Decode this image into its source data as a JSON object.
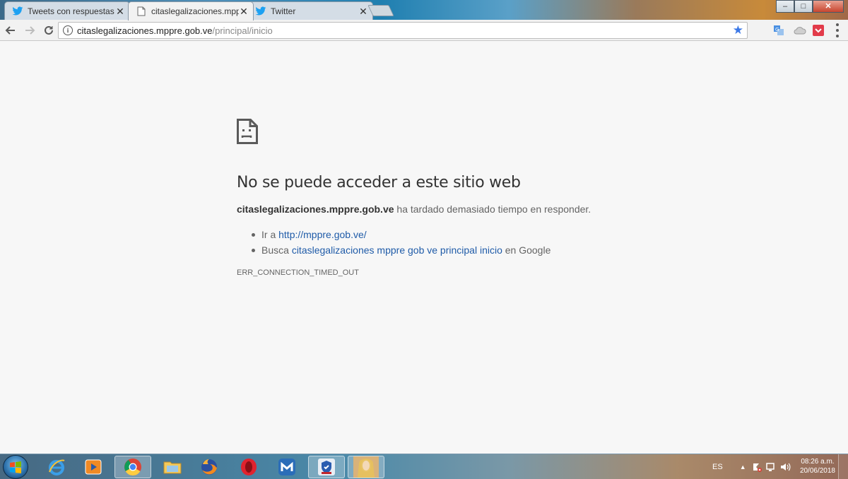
{
  "browser": {
    "tabs": [
      {
        "title": "Tweets con respuestas p",
        "icon": "twitter-icon",
        "active": false
      },
      {
        "title": "citaslegalizaciones.mppre",
        "icon": "page-icon",
        "active": true
      },
      {
        "title": "Twitter",
        "icon": "twitter-icon",
        "active": false
      }
    ],
    "window_controls": {
      "minimize": "–",
      "maximize": "□",
      "close": "✕"
    },
    "address": {
      "host": "citaslegalizaciones.mppre.gob.ve",
      "path": "/principal/inicio"
    }
  },
  "error_page": {
    "heading": "No se puede acceder a este sitio web",
    "desc_host": "citaslegalizaciones.mppre.gob.ve",
    "desc_rest": " ha tardado demasiado tiempo en responder.",
    "suggestions": {
      "go_prefix": "Ir a ",
      "go_link": "http://mppre.gob.ve/",
      "search_prefix": "Busca ",
      "search_link": "citaslegalizaciones mppre gob ve principal inicio",
      "search_suffix": " en Google"
    },
    "error_code": "ERR_CONNECTION_TIMED_OUT"
  },
  "taskbar": {
    "apps": [
      "internet-explorer-icon",
      "media-player-icon",
      "chrome-icon",
      "file-explorer-icon",
      "firefox-icon",
      "opera-icon",
      "maxthon-icon",
      "mcafee-icon",
      "user-photo-icon"
    ],
    "tray": {
      "language": "ES",
      "time": "08:26 a.m.",
      "date": "20/06/2018"
    }
  },
  "colors": {
    "link": "#1f5ba8",
    "bookmark_star": "#3b78e7",
    "page_bg": "#f7f7f7"
  }
}
